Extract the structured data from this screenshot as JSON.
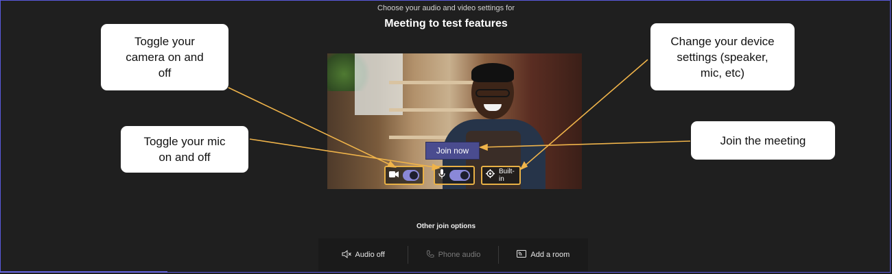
{
  "header": {
    "subtitle": "Choose your audio and video settings for",
    "meeting_title": "Meeting to test features"
  },
  "preview": {
    "join_label": "Join now",
    "camera_toggle": {
      "icon": "camera-icon",
      "on": true
    },
    "mic_toggle": {
      "icon": "microphone-icon",
      "on": true
    },
    "device_settings": {
      "icon": "gear-icon",
      "label": "Built-in"
    }
  },
  "callouts": {
    "camera": {
      "line1": "Toggle your",
      "line2": "camera on and",
      "line3": "off"
    },
    "mic": {
      "line1": "Toggle your mic",
      "line2": "on and off"
    },
    "device": {
      "line1": "Change your device",
      "line2": "settings (speaker,",
      "line3": "mic, etc)"
    },
    "join": {
      "line1": "Join the meeting"
    }
  },
  "other_options": {
    "title": "Other join options",
    "items": [
      {
        "label": "Audio off",
        "icon": "speaker-muted-icon",
        "enabled": true
      },
      {
        "label": "Phone audio",
        "icon": "phone-icon",
        "enabled": false
      },
      {
        "label": "Add a room",
        "icon": "room-cast-icon",
        "enabled": true
      }
    ]
  },
  "colors": {
    "background": "#1f1f1f",
    "accent_outline": "#e9b145",
    "toggle_on": "#8a88d8",
    "join_button": "#4a4c8f",
    "callout_bg": "#ffffff"
  }
}
